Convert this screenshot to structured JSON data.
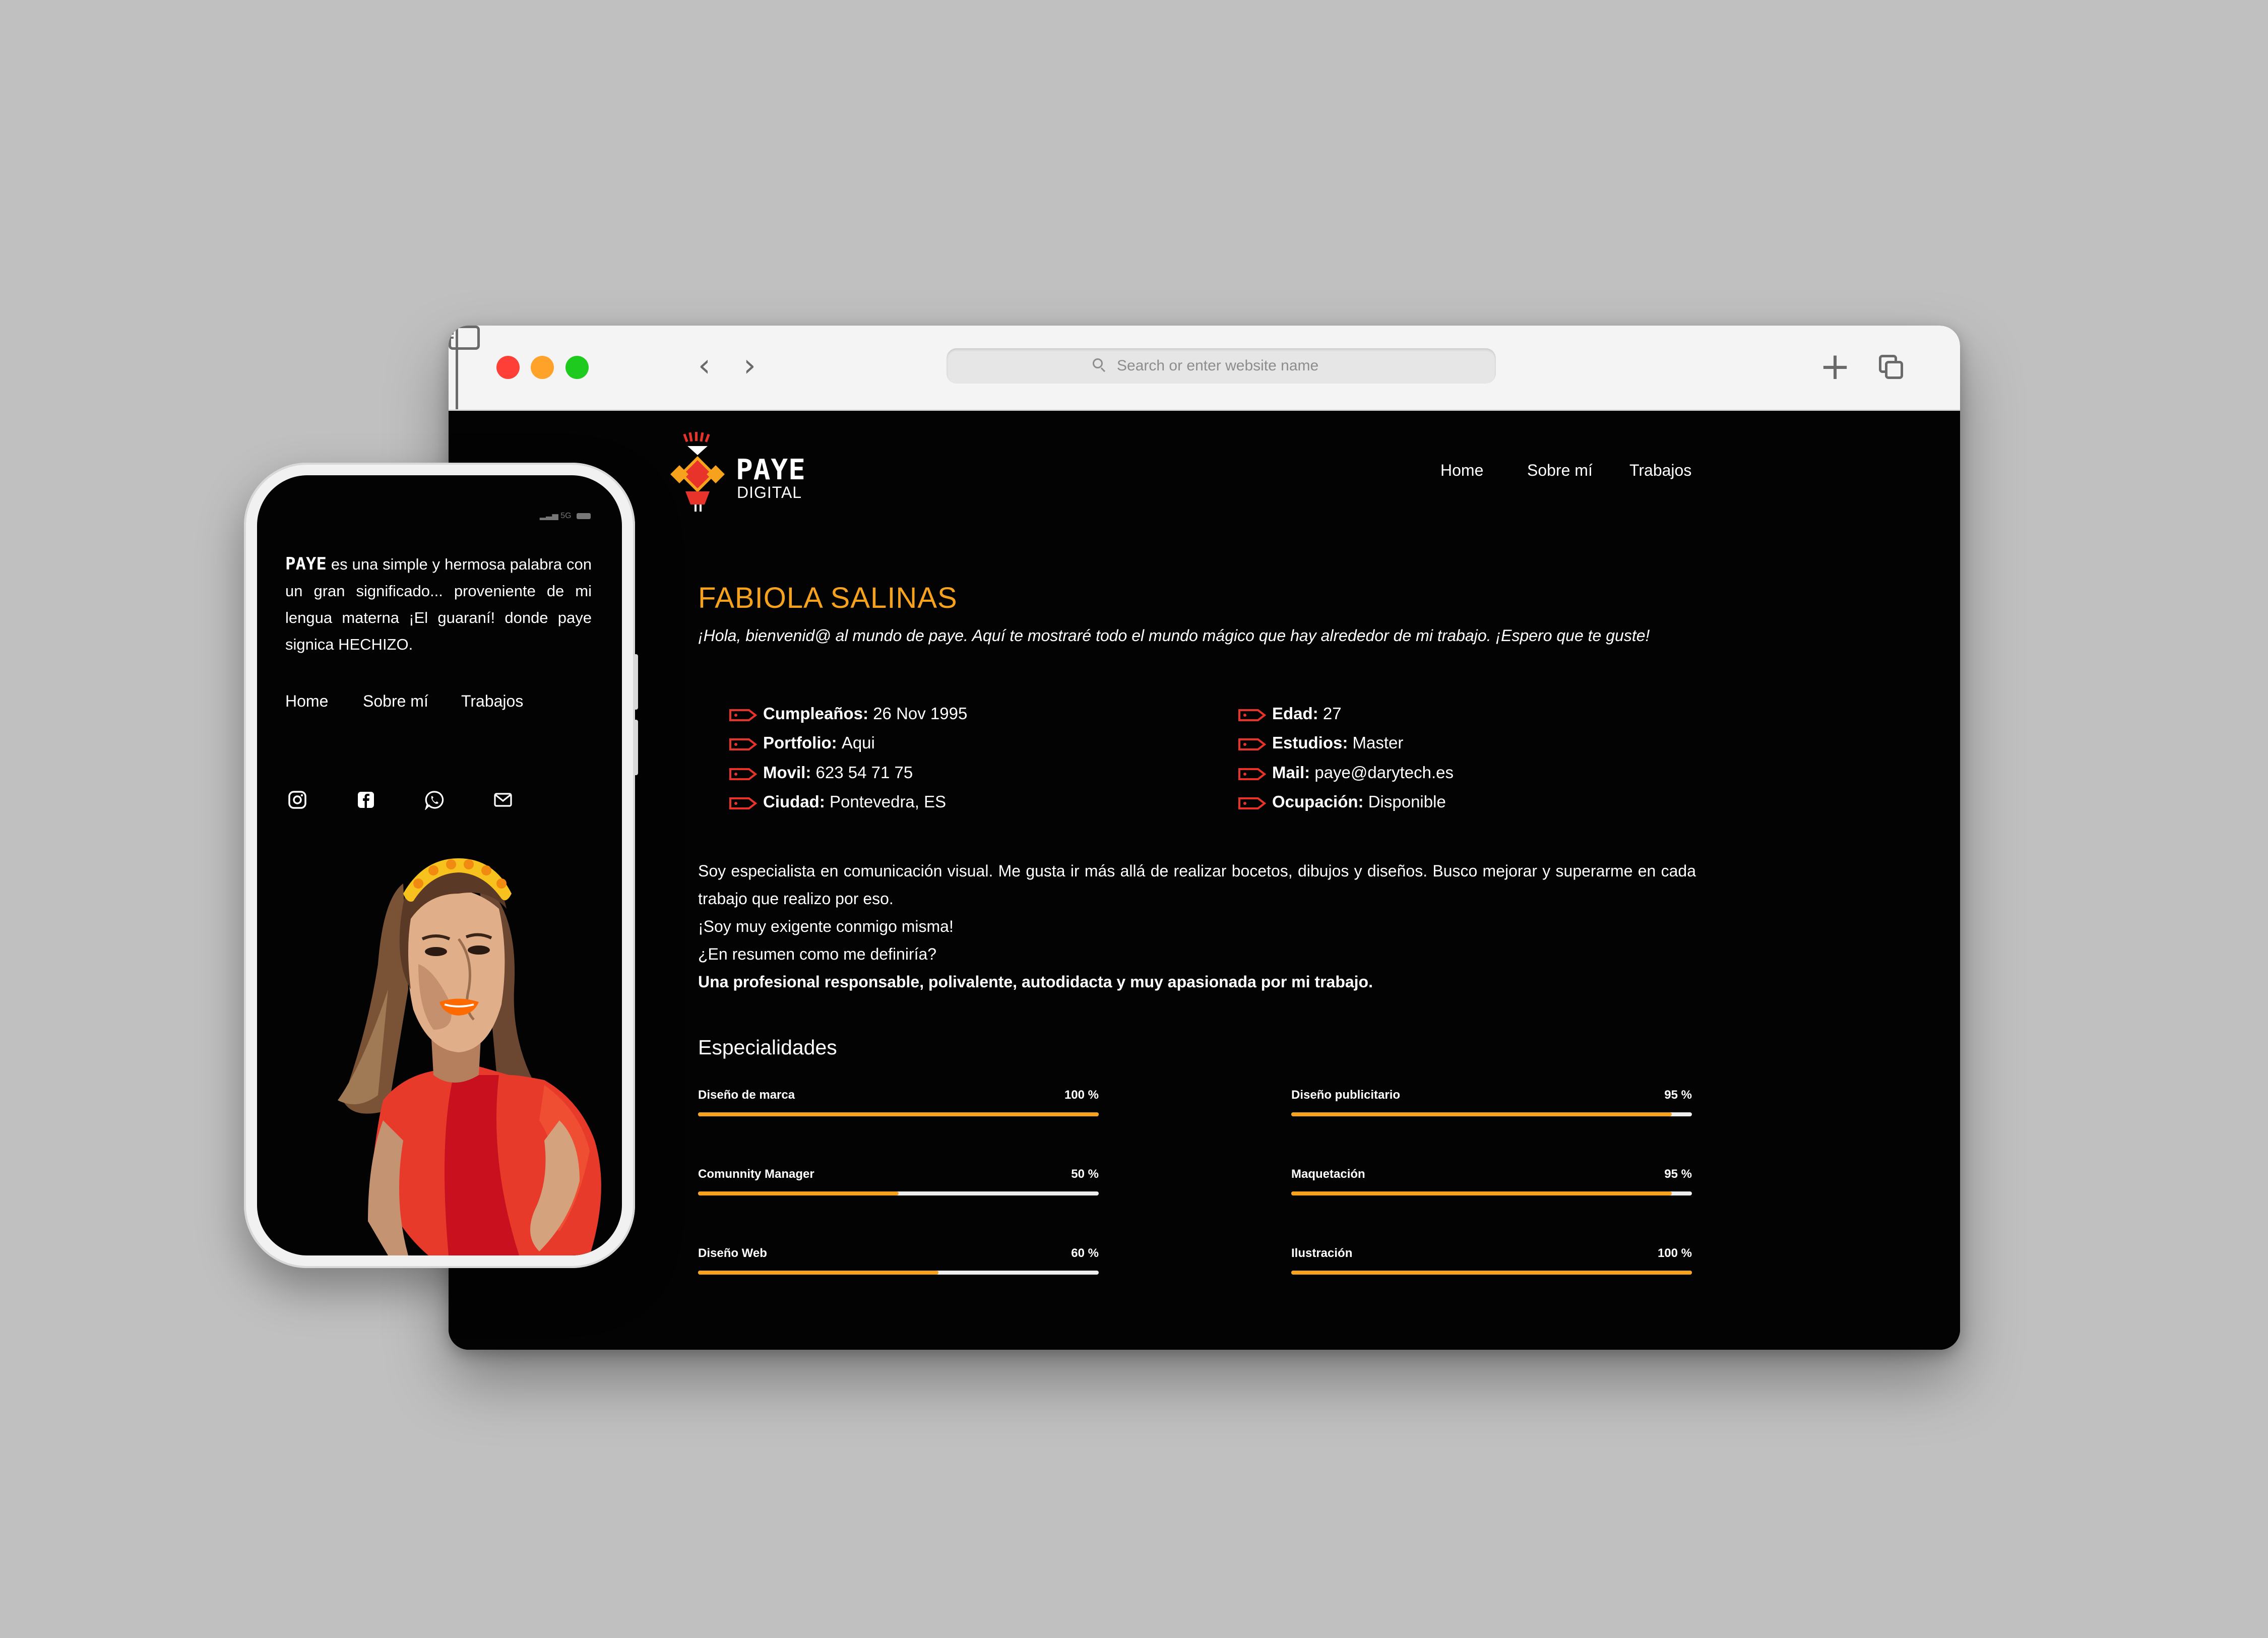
{
  "browser": {
    "address_placeholder": "Search or enter website name"
  },
  "site": {
    "logo_word": "PAYE",
    "logo_sub": "DIGITAL",
    "nav": [
      "Home",
      "Sobre mí",
      "Trabajos"
    ],
    "name": "FABIOLA SALINAS",
    "intro": "¡Hola, bienvenid@ al mundo de paye. Aquí te mostraré todo el mundo mágico que hay alrededor de mi trabajo. ¡Espero que te guste!",
    "info_left": [
      {
        "label": "Cumpleaños:",
        "value": "26 Nov 1995"
      },
      {
        "label": "Portfolio:",
        "value": "Aqui"
      },
      {
        "label": "Movil:",
        "value": "623 54 71 75"
      },
      {
        "label": "Ciudad:",
        "value": "Pontevedra, ES"
      }
    ],
    "info_right": [
      {
        "label": "Edad:",
        "value": "27"
      },
      {
        "label": "Estudios:",
        "value": "Master"
      },
      {
        "label": "Mail:",
        "value": "paye@darytech.es"
      },
      {
        "label": "Ocupación:",
        "value": "Disponible"
      }
    ],
    "about": [
      "Soy especialista en comunicación visual. Me gusta ir más allá de realizar bocetos, dibujos y diseños. Busco mejorar y superarme en cada trabajo que realizo por eso.",
      "¡Soy muy exigente conmigo misma!",
      "¿En resumen como me definiría?",
      "Una profesional responsable, polivalente, autodidacta y muy apasionada por mi trabajo."
    ],
    "specialties_title": "Especialidades",
    "skills_left": [
      {
        "name": "Diseño de marca",
        "pct_label": "100 %",
        "value": 100
      },
      {
        "name": "Comunnity Manager",
        "pct_label": "50 %",
        "value": 50
      },
      {
        "name": "Diseño Web",
        "pct_label": "60 %",
        "value": 60
      }
    ],
    "skills_right": [
      {
        "name": "Diseño publicitario",
        "pct_label": "95 %",
        "value": 95
      },
      {
        "name": "Maquetación",
        "pct_label": "95 %",
        "value": 95
      },
      {
        "name": "Ilustración",
        "pct_label": "100 %",
        "value": 100
      }
    ]
  },
  "mobile": {
    "status_text": "5G",
    "brand": "PAYE",
    "intro": " es una simple y hermosa palabra con un gran significado... proveniente de mi lengua materna ¡El guaraní! donde paye signica HECHIZO.",
    "nav": [
      "Home",
      "Sobre mí",
      "Trabajos"
    ],
    "social_icons": [
      "instagram-icon",
      "facebook-icon",
      "whatsapp-icon",
      "mail-icon"
    ]
  },
  "colors": {
    "accent": "#f7a21d",
    "tag_red": "#e8332a",
    "page_bg": "#030303"
  }
}
